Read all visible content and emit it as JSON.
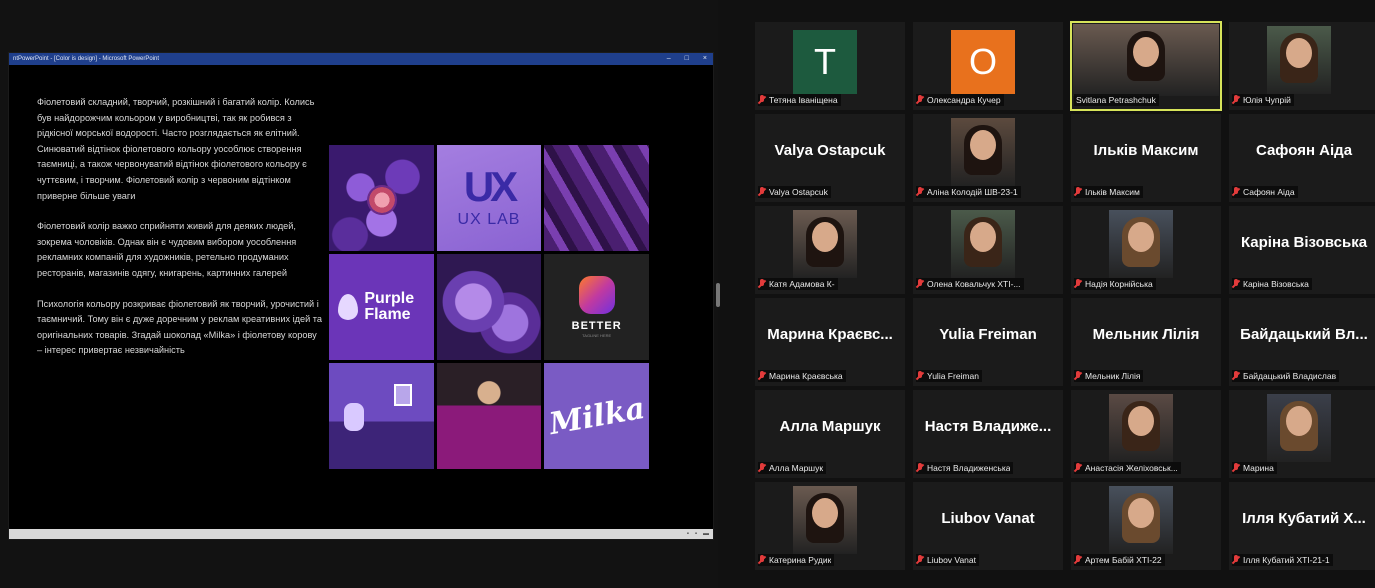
{
  "share": {
    "window_title": "ntPowerPoint - [Color is design] - Microsoft PowerPoint",
    "window_controls": [
      "–",
      "□",
      "×"
    ],
    "slide_paragraphs": [
      "Фіолетовий складний, творчий, розкішний і багатий колір. Колись був найдорожчим кольором у виробництві, так як робився з рідкісної морської водорості. Часто розглядається як елітний. Синюватий відтінок фіолетового кольору уособлює створення таємниці, а також червонуватий відтінок фіолетового кольору є чуттєвим, і творчим. Фіолетовий колір з червоним відтінком приверне більше уваги",
      "Фіолетовий колір важко сприйняти живий для деяких людей, зокрема чоловіків. Однак він є чудовим вибором уособлення рекламних компаній для художників, ретельно продуманих ресторанів, магазинів одягу, книгарень, картинних галерей",
      "Психологія кольору розкриває фіолетовий як творчий, урочистий і таємничий. Тому він є дуже доречним у реклам креативних ідей та оригінальних товарів. Згадай шоколад «Milka» і фіолетову корову – інтерес привертає незвичайність"
    ],
    "moodboard": {
      "ux_mark": "UX",
      "ux_label": "UX LAB",
      "purple_flame": "Purple Flame",
      "better": "BETTER",
      "better_sub": "TAGLINE HERE",
      "milka": "Milka"
    }
  },
  "participants": [
    {
      "key": "tetiana",
      "big": "",
      "avatar_letter": "T",
      "avatar_color": "#1d5a3e",
      "name": "Тетяна Іваніщена",
      "muted": true
    },
    {
      "key": "oleksandra",
      "big": "",
      "avatar_letter": "O",
      "avatar_color": "#e8711d",
      "name": "Олександра Кучер",
      "muted": true
    },
    {
      "key": "svitlana",
      "big": "",
      "video": true,
      "name": "Svitlana Petrashchuk",
      "muted": false,
      "active": true
    },
    {
      "key": "yulia-chupr",
      "big": "",
      "video": true,
      "name": "Юлія Чупрій",
      "muted": true
    },
    {
      "key": "valya",
      "big": "Valya Ostapcuk",
      "name": "Valya Ostapcuk",
      "muted": true
    },
    {
      "key": "alina",
      "big": "",
      "video": true,
      "name": "Аліна Колодій ШВ-23-1",
      "muted": true
    },
    {
      "key": "ilkiv",
      "big": "Ільків Максим",
      "name": "Ільків Максим",
      "muted": true
    },
    {
      "key": "safoian",
      "big": "Сафоян Аіда",
      "name": "Сафоян Аіда",
      "muted": true
    },
    {
      "key": "katia",
      "big": "",
      "video": true,
      "name": "Катя Адамова К-",
      "muted": true
    },
    {
      "key": "olena",
      "big": "",
      "video": true,
      "name": "Олена Ковальчук ХТІ-...",
      "muted": true
    },
    {
      "key": "nadia",
      "big": "",
      "video": true,
      "name": "Надія Корнійська",
      "muted": true
    },
    {
      "key": "karina",
      "big": "Каріна Візовська",
      "name": "Каріна Візовська",
      "muted": true
    },
    {
      "key": "maryna-kr",
      "big": "Марина Краєвс...",
      "name": "Марина Краєвська",
      "muted": true
    },
    {
      "key": "yulia-f",
      "big": "Yulia Freiman",
      "name": "Yulia Freiman",
      "muted": true
    },
    {
      "key": "melnyk",
      "big": "Мельник Лілія",
      "name": "Мельник Лілія",
      "muted": true
    },
    {
      "key": "baidatskyi",
      "big": "Байдацький Вл...",
      "name": "Байдацький Владислав",
      "muted": true
    },
    {
      "key": "alla",
      "big": "Алла Маршук",
      "name": "Алла Маршук",
      "muted": true
    },
    {
      "key": "nastia",
      "big": "Настя Владиже...",
      "name": "Настя Владиженська",
      "muted": true
    },
    {
      "key": "anastasia",
      "big": "",
      "video": true,
      "name": "Анастасія Желіховськ...",
      "muted": true
    },
    {
      "key": "maryna",
      "big": "",
      "video": true,
      "name": "Марина",
      "muted": true
    },
    {
      "key": "kateryna",
      "big": "",
      "video": true,
      "name": "Катерина Рудик",
      "muted": true
    },
    {
      "key": "liubov",
      "big": "Liubov Vanat",
      "name": "Liubov Vanat",
      "muted": true
    },
    {
      "key": "artem",
      "big": "",
      "video": true,
      "name": "Артем Бабій ХТІ-22",
      "muted": true
    },
    {
      "key": "illia",
      "big": "Ілля Кубатий Х...",
      "name": "Ілля Кубатий ХТІ-21-1",
      "muted": true
    }
  ],
  "colors": {
    "active_speaker": "#d7e45a",
    "mute": "#e23b3b"
  }
}
